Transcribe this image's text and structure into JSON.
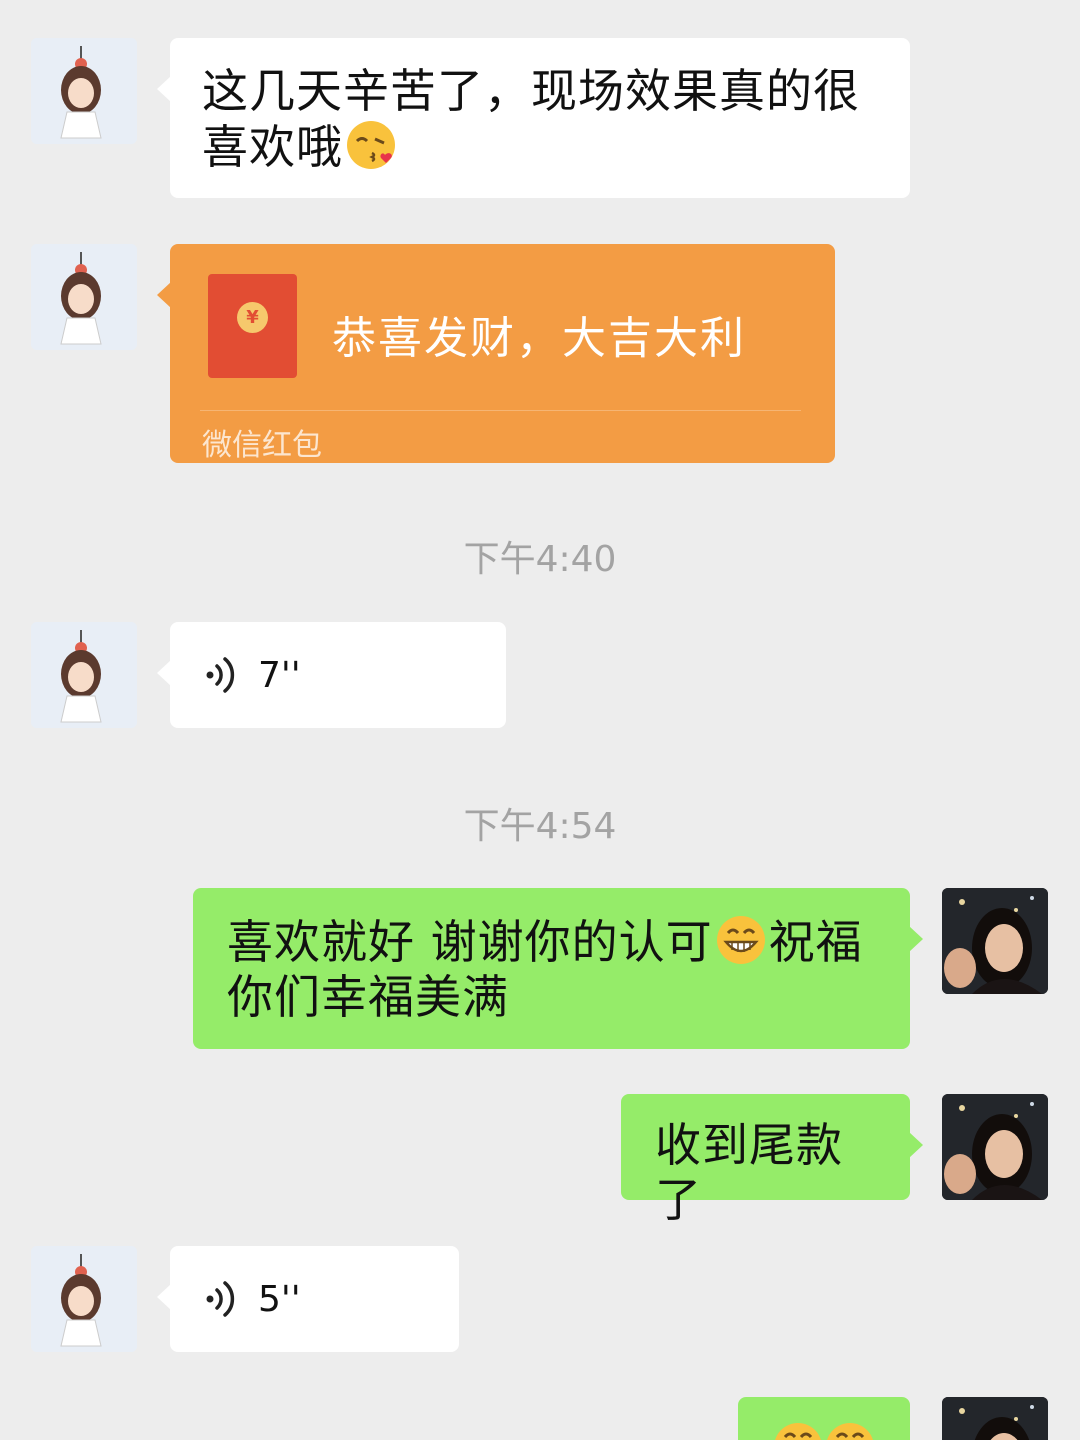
{
  "messages": [
    {
      "side": "left",
      "type": "text",
      "text_before": "这几天辛苦了，现场效果真的很喜欢哦",
      "emoji": "kissing-face-with-heart-emoji"
    },
    {
      "side": "left",
      "type": "red_packet",
      "title": "恭喜发财，大吉大利",
      "label": "微信红包",
      "currency_symbol": "¥"
    },
    {
      "type": "timestamp",
      "text": "下午4:40"
    },
    {
      "side": "left",
      "type": "voice",
      "duration": "7''"
    },
    {
      "type": "timestamp",
      "text": "下午4:54"
    },
    {
      "side": "right",
      "type": "text",
      "text_before": "喜欢就好 谢谢你的认可",
      "emoji": "grinning-face-emoji",
      "text_after": "祝福你们幸福美满"
    },
    {
      "side": "right",
      "type": "text",
      "text": "收到尾款了"
    },
    {
      "side": "left",
      "type": "voice",
      "duration": "5''"
    },
    {
      "side": "right",
      "type": "emoji-only",
      "emoji": "grinning-faces-emoji"
    }
  ],
  "colors": {
    "background": "#ededed",
    "bubble_left": "#ffffff",
    "bubble_right": "#95ec69",
    "red_packet": "#f39c44",
    "timestamp_text": "#a3a3a3"
  }
}
